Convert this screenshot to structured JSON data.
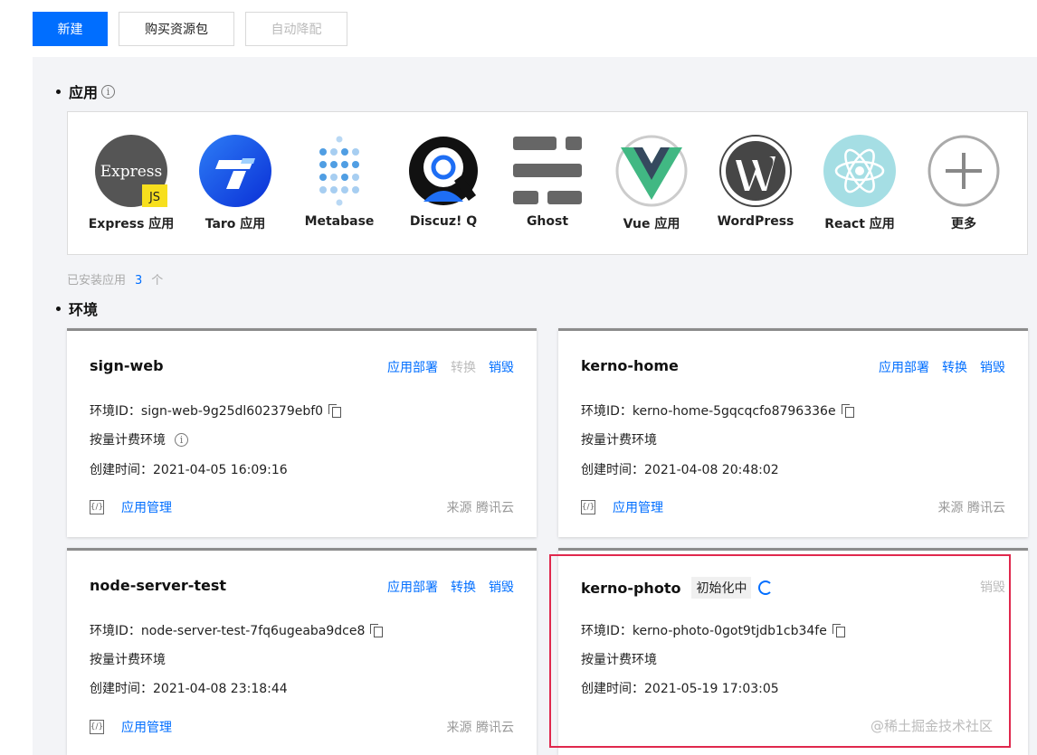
{
  "toolbar": {
    "new_label": "新建",
    "buy_label": "购买资源包",
    "downgrade_label": "自动降配"
  },
  "apps_section": {
    "title": "应用"
  },
  "apps": [
    {
      "label": "Express 应用",
      "icon": "express-logo",
      "badge": "JS",
      "logo_text": "Express"
    },
    {
      "label": "Taro 应用",
      "icon": "taro-logo"
    },
    {
      "label": "Metabase",
      "icon": "metabase-logo"
    },
    {
      "label": "Discuz! Q",
      "icon": "discuz-logo"
    },
    {
      "label": "Ghost",
      "icon": "ghost-logo"
    },
    {
      "label": "Vue 应用",
      "icon": "vue-logo"
    },
    {
      "label": "WordPress",
      "icon": "wordpress-logo"
    },
    {
      "label": "React 应用",
      "icon": "react-logo"
    },
    {
      "label": "更多",
      "icon": "plus-icon"
    }
  ],
  "installed": {
    "prefix": "已安装应用",
    "count": "3",
    "suffix": "个"
  },
  "env_section": {
    "title": "环境"
  },
  "envs": [
    {
      "name": "sign-web",
      "actions": [
        {
          "label": "应用部署",
          "enabled": true
        },
        {
          "label": "转换",
          "enabled": false
        },
        {
          "label": "销毁",
          "enabled": true
        }
      ],
      "env_id": "环境ID：sign-web-9g25dl602379ebf0",
      "billing": "按量计费环境",
      "created": "创建时间：2021-04-05 16:09:16",
      "manage_label": "应用管理",
      "source": "来源 腾讯云"
    },
    {
      "name": "kerno-home",
      "actions": [
        {
          "label": "应用部署",
          "enabled": true
        },
        {
          "label": "转换",
          "enabled": true
        },
        {
          "label": "销毁",
          "enabled": true
        }
      ],
      "env_id": "环境ID：kerno-home-5gqcqcfo8796336e",
      "billing": "按量计费环境",
      "created": "创建时间：2021-04-08 20:48:02",
      "manage_label": "应用管理",
      "source": "来源 腾讯云"
    },
    {
      "name": "node-server-test",
      "actions": [
        {
          "label": "应用部署",
          "enabled": true
        },
        {
          "label": "转换",
          "enabled": true
        },
        {
          "label": "销毁",
          "enabled": true
        }
      ],
      "env_id": "环境ID：node-server-test-7fq6ugeaba9dce8",
      "billing": "按量计费环境",
      "created": "创建时间：2021-04-08 23:18:44",
      "manage_label": "应用管理",
      "source": "来源 腾讯云"
    },
    {
      "name": "kerno-photo",
      "status": "初始化中",
      "actions": [
        {
          "label": "销毁",
          "enabled": false
        }
      ],
      "env_id": "环境ID：kerno-photo-0got9tjdb1cb34fe",
      "billing": "按量计费环境",
      "created": "创建时间：2021-05-19 17:03:05"
    }
  ],
  "watermark": "@稀土掘金技术社区",
  "colors": {
    "primary": "#006eff",
    "highlight": "#e0284d"
  }
}
